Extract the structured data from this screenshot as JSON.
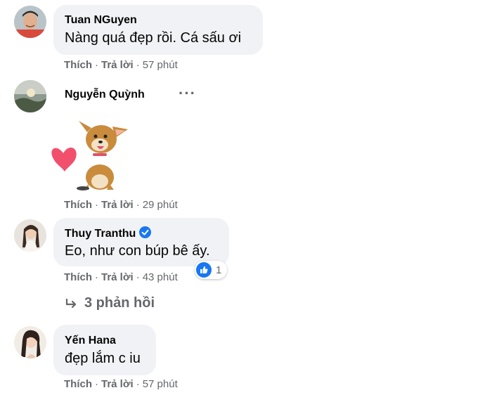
{
  "comments": [
    {
      "author": "Tuan NGuyen",
      "text": "Nàng quá đẹp rồi. Cá sấu ơi",
      "like_label": "Thích",
      "reply_label": "Trả lời",
      "time": "57 phút"
    },
    {
      "author": "Nguyễn Quỳnh",
      "more_label": "···",
      "sticker_icon": "corgi-heart-sticker-icon",
      "like_label": "Thích",
      "reply_label": "Trả lời",
      "time": "29 phút"
    },
    {
      "author": "Thuy Tranthu",
      "verified": true,
      "text": "Eo, như con búp bê ấy.",
      "like_label": "Thích",
      "reply_label": "Trả lời",
      "time": "43 phút",
      "reaction_count": "1",
      "replies_label": "3 phản hồi"
    },
    {
      "author": "Yến Hana",
      "text": "đẹp lắm c iu",
      "like_label": "Thích",
      "reply_label": "Trả lời",
      "time": "57 phút"
    }
  ],
  "colors": {
    "bubble": "#f0f2f5",
    "secondary_text": "#65676b",
    "verified_blue": "#1877f2",
    "like_blue": "#1877f2"
  }
}
